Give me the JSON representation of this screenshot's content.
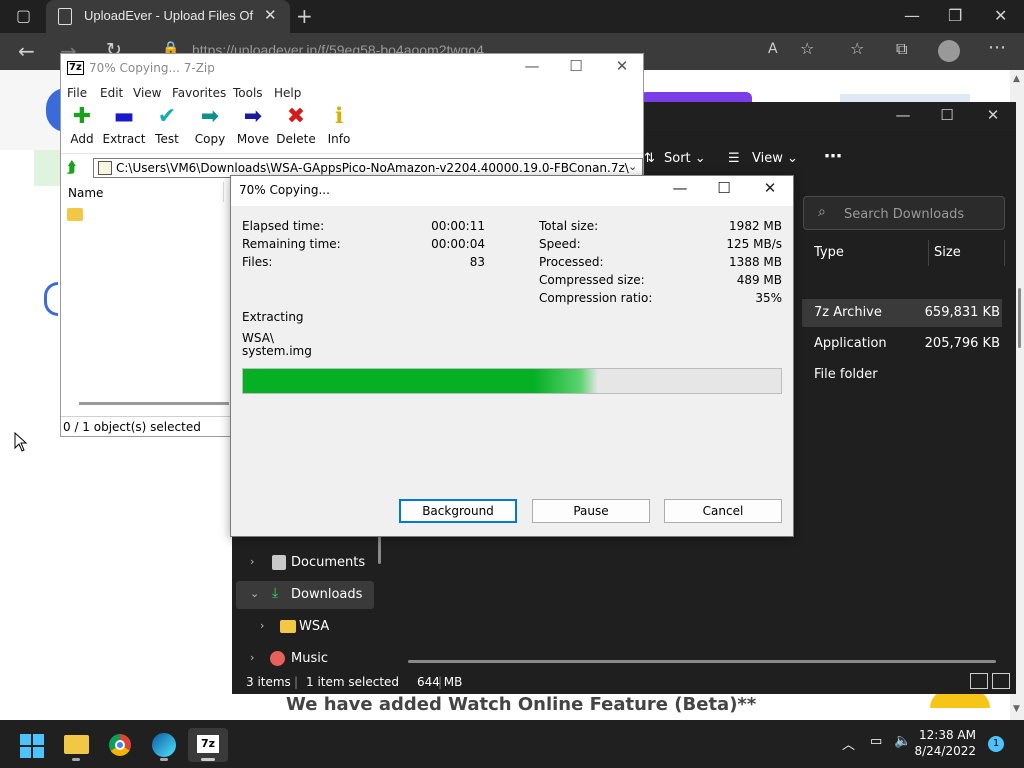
{
  "browser": {
    "tab_title": "UploadEver - Upload Files Of An",
    "address": "https://uploadever.in/f/59eq58-bo4aoom2twgo4"
  },
  "webpage": {
    "heading": "We have added Watch Online Feature (Beta)**"
  },
  "explorer": {
    "cmd_sort": "Sort",
    "cmd_view": "View",
    "search_placeholder": "Search Downloads",
    "col_type": "Type",
    "col_size": "Size",
    "rows": [
      {
        "type": "7z Archive",
        "size": "659,831 KB"
      },
      {
        "type": "Application",
        "size": "205,796 KB"
      },
      {
        "type": "File folder",
        "size": ""
      }
    ],
    "nav": [
      {
        "label": "Documents"
      },
      {
        "label": "Downloads"
      },
      {
        "label": "WSA"
      },
      {
        "label": "Music"
      }
    ],
    "status_items": "3 items",
    "status_selected": "1 item selected",
    "status_size": "644 MB"
  },
  "sevenzip": {
    "title": "70% Copying... 7-Zip",
    "menu": [
      "File",
      "Edit",
      "View",
      "Favorites",
      "Tools",
      "Help"
    ],
    "tools": [
      {
        "label": "Add",
        "color": "#1aa31a",
        "glyph": "✚"
      },
      {
        "label": "Extract",
        "color": "#1a1ac8",
        "glyph": "▬"
      },
      {
        "label": "Test",
        "color": "#10b0b0",
        "glyph": "✔"
      },
      {
        "label": "Copy",
        "color": "#10908a",
        "glyph": "➡"
      },
      {
        "label": "Move",
        "color": "#1a1aa0",
        "glyph": "➡"
      },
      {
        "label": "Delete",
        "color": "#d41a1a",
        "glyph": "✖"
      },
      {
        "label": "Info",
        "color": "#d4b000",
        "glyph": "ℹ"
      }
    ],
    "path": "C:\\Users\\VM6\\Downloads\\WSA-GAppsPico-NoAmazon-v2204.40000.19.0-FBConan.7z\\",
    "col_name": "Name",
    "status": "0 / 1 object(s) selected"
  },
  "progress_dialog": {
    "title": "70% Copying...",
    "left": [
      {
        "label": "Elapsed time:",
        "value": "00:00:11"
      },
      {
        "label": "Remaining time:",
        "value": "00:00:04"
      },
      {
        "label": "Files:",
        "value": "83"
      }
    ],
    "right": [
      {
        "label": "Total size:",
        "value": "1982 MB"
      },
      {
        "label": "Speed:",
        "value": "125 MB/s"
      },
      {
        "label": "Processed:",
        "value": "1388 MB"
      },
      {
        "label": "Compressed size:",
        "value": "489 MB"
      },
      {
        "label": "Compression ratio:",
        "value": "35%"
      }
    ],
    "operation": "Extracting",
    "current_dir": "WSA\\",
    "current_file": "system.img",
    "progress": 0.66,
    "btn_background": "Background",
    "btn_pause": "Pause",
    "btn_cancel": "Cancel"
  },
  "taskbar": {
    "time": "12:38 AM",
    "date": "8/24/2022",
    "notification_count": "1"
  }
}
